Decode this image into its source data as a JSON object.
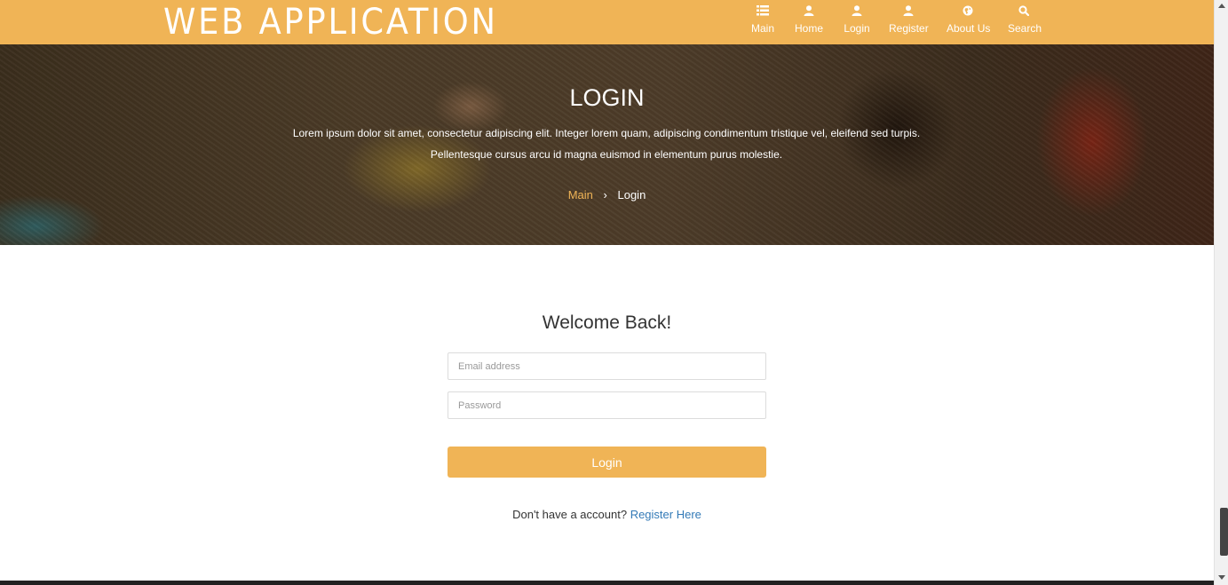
{
  "header": {
    "brand": "WEB APPLICATION",
    "nav": [
      {
        "label": "Main",
        "icon": "list-icon"
      },
      {
        "label": "Home",
        "icon": "user-icon"
      },
      {
        "label": "Login",
        "icon": "user-icon"
      },
      {
        "label": "Register",
        "icon": "user-icon"
      },
      {
        "label": "About Us",
        "icon": "globe-icon"
      },
      {
        "label": "Search",
        "icon": "search-icon"
      }
    ]
  },
  "hero": {
    "title": "LOGIN",
    "text": "Lorem ipsum dolor sit amet, consectetur adipiscing elit. Integer lorem quam, adipiscing condimentum tristique vel, eleifend sed turpis. Pellentesque cursus arcu id magna euismod in elementum purus molestie.",
    "breadcrumb": {
      "link": "Main",
      "separator": "›",
      "current": "Login"
    }
  },
  "form": {
    "title": "Welcome Back!",
    "email_placeholder": "Email address",
    "password_placeholder": "Password",
    "submit_label": "Login",
    "register_prompt": "Don't have a account?",
    "register_link": "Register Here"
  },
  "colors": {
    "accent": "#f0b456",
    "link": "#337ab7"
  }
}
